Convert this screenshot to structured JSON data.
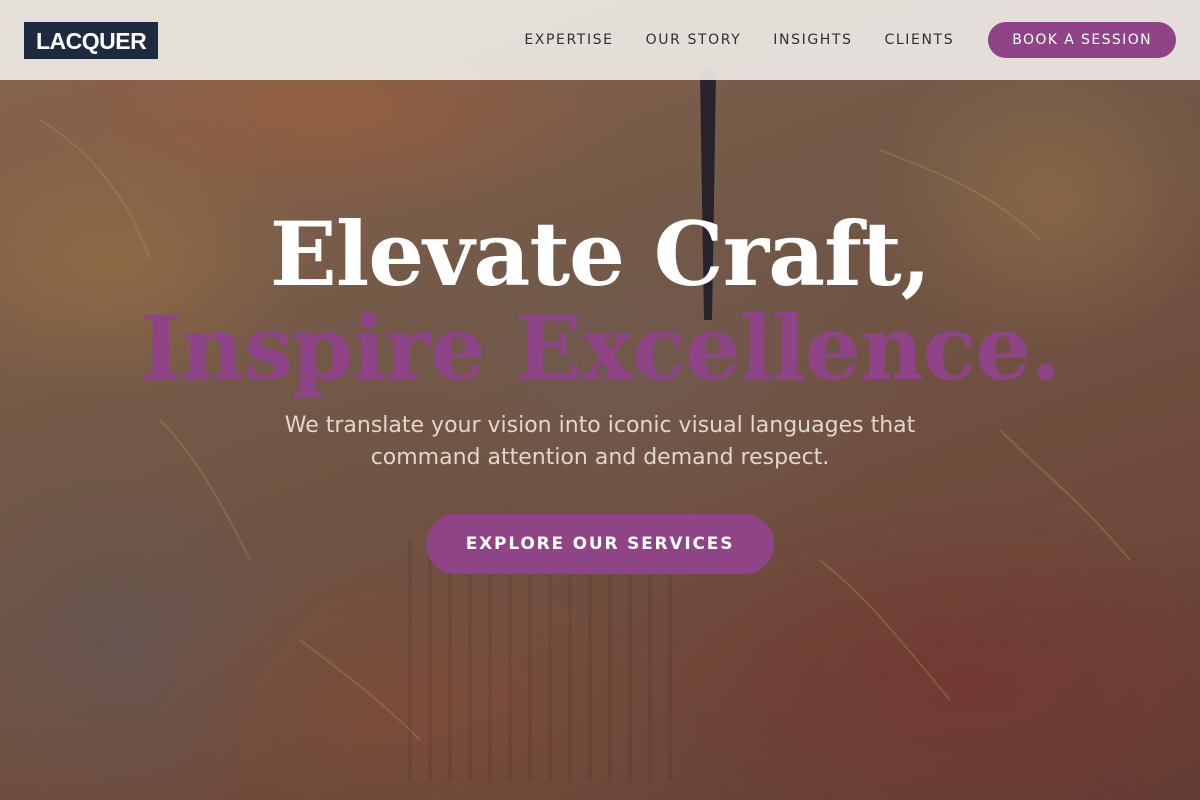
{
  "brand": {
    "logo_text": "LACQUER",
    "logo_bg": "#1d2a3f",
    "accent": "#8e4486"
  },
  "nav": {
    "items": [
      {
        "label": "EXPERTISE"
      },
      {
        "label": "OUR STORY"
      },
      {
        "label": "INSIGHTS"
      },
      {
        "label": "CLIENTS"
      }
    ],
    "cta_label": "BOOK A SESSION"
  },
  "hero": {
    "headline_line1": "Elevate Craft,",
    "headline_line2": "Inspire Excellence.",
    "subtitle": "We translate your vision into iconic visual languages that command attention and demand respect.",
    "cta_label": "EXPLORE OUR SERVICES",
    "background": "textured painted canvas"
  }
}
